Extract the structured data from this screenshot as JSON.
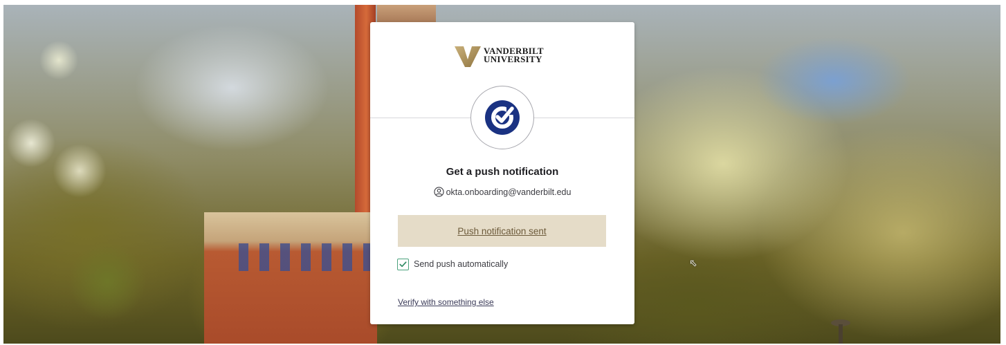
{
  "brand": {
    "line1": "VANDERBILT",
    "line2": "UNIVERSITY",
    "gold": "#b39758",
    "navy": "#1a3282"
  },
  "auth": {
    "title": "Get a push notification",
    "identity": "okta.onboarding@vanderbilt.edu",
    "push_button_label": "Push notification sent",
    "auto_push_label": "Send push automatically",
    "auto_push_checked": true,
    "verify_other_label": "Verify with something else"
  },
  "icons": {
    "factor": "okta-verify-check-icon",
    "user": "user-circle-icon",
    "checkbox": "checkmark-icon"
  }
}
